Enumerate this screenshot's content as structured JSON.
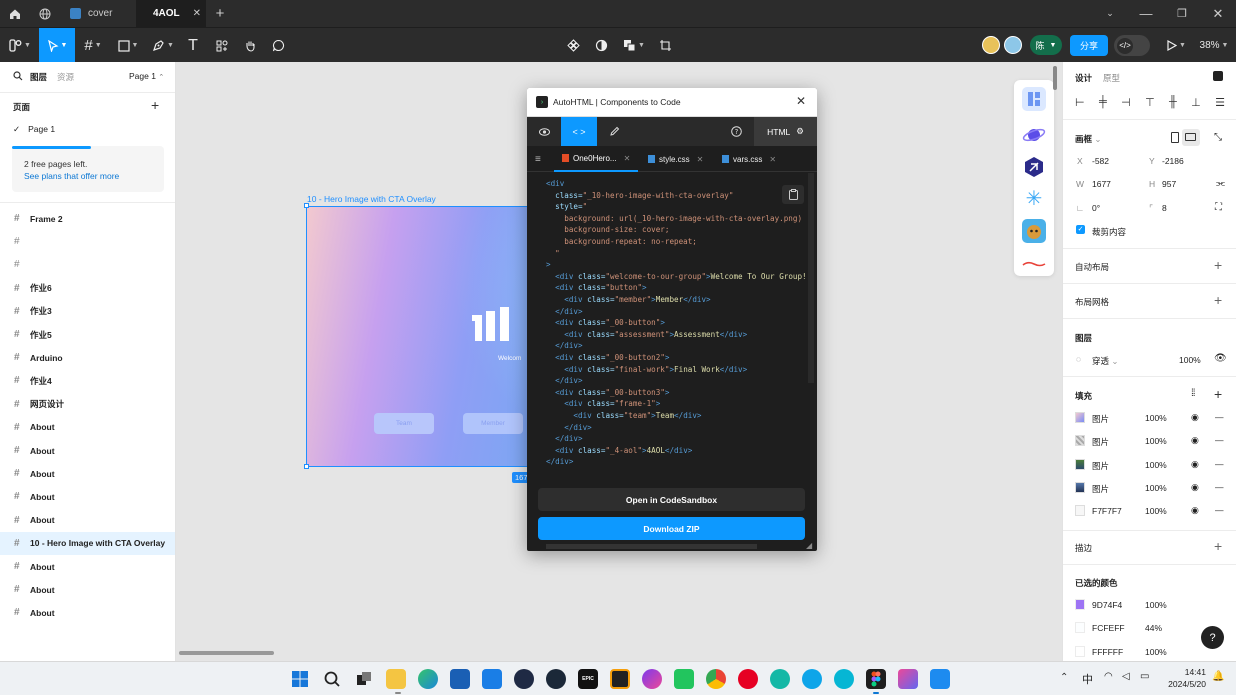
{
  "tabs": [
    {
      "label": "cover",
      "active": false
    },
    {
      "label": "4AOL",
      "active": true
    }
  ],
  "toolbar": {
    "share_label": "分享",
    "zoom": "38%",
    "avatar_letter": "陈"
  },
  "left_panel": {
    "tab_layers": "图层",
    "tab_assets": "资源",
    "page_selector": "Page 1",
    "pages_title": "页面",
    "current_page": "Page 1",
    "notice_text": "2 free pages left.",
    "notice_link": "See plans that offer more",
    "layers": [
      {
        "label": "Frame 2",
        "selected": false
      },
      {
        "label": "",
        "selected": false
      },
      {
        "label": "",
        "selected": false
      },
      {
        "label": "作业6",
        "selected": false
      },
      {
        "label": "作业3",
        "selected": false
      },
      {
        "label": "作业5",
        "selected": false
      },
      {
        "label": "Arduino",
        "selected": false
      },
      {
        "label": "作业4",
        "selected": false
      },
      {
        "label": "网页设计",
        "selected": false
      },
      {
        "label": "About",
        "selected": false
      },
      {
        "label": "About",
        "selected": false
      },
      {
        "label": "About",
        "selected": false
      },
      {
        "label": "About",
        "selected": false
      },
      {
        "label": "About",
        "selected": false
      },
      {
        "label": "10 - Hero Image with CTA Overlay",
        "selected": true
      },
      {
        "label": "About",
        "selected": false
      },
      {
        "label": "About",
        "selected": false
      },
      {
        "label": "About",
        "selected": false
      }
    ]
  },
  "canvas": {
    "frame_label": "10 - Hero Image with CTA Overlay",
    "frame_size": "167",
    "welcome_text": "Welcom",
    "btn_team": "Team",
    "btn_member": "Member"
  },
  "plugin": {
    "title": "AutoHTML | Components to Code",
    "lang": "HTML",
    "files": [
      "One0Hero...",
      "style.css",
      "vars.css"
    ],
    "code": [
      [
        [
          "t",
          "<div"
        ]
      ],
      [
        [
          "a",
          "  class="
        ],
        [
          "s",
          "\"_10-hero-image-with-cta-overlay\""
        ]
      ],
      [
        [
          "a",
          "  style="
        ],
        [
          "s",
          "\""
        ]
      ],
      [
        [
          "s",
          "    background: url(_10-hero-image-with-cta-overlay.png)"
        ]
      ],
      [
        [
          "s",
          "    background-size: cover;"
        ]
      ],
      [
        [
          "s",
          "    background-repeat: no-repeat;"
        ]
      ],
      [
        [
          "s",
          "  \""
        ]
      ],
      [
        [
          "t",
          ">"
        ]
      ],
      [
        [
          "t",
          "  <div "
        ],
        [
          "a",
          "class="
        ],
        [
          "s",
          "\"welcome-to-our-group\""
        ],
        [
          "t",
          ">"
        ],
        [
          "x",
          "Welcome To Our Group!"
        ]
      ],
      [
        [
          "t",
          "  <div "
        ],
        [
          "a",
          "class="
        ],
        [
          "s",
          "\"button\""
        ],
        [
          "t",
          ">"
        ]
      ],
      [
        [
          "t",
          "    <div "
        ],
        [
          "a",
          "class="
        ],
        [
          "s",
          "\"member\""
        ],
        [
          "t",
          ">"
        ],
        [
          "x",
          "Member"
        ],
        [
          "t",
          "</div>"
        ]
      ],
      [
        [
          "t",
          "  </div>"
        ]
      ],
      [
        [
          "t",
          "  <div "
        ],
        [
          "a",
          "class="
        ],
        [
          "s",
          "\"_00-button\""
        ],
        [
          "t",
          ">"
        ]
      ],
      [
        [
          "t",
          "    <div "
        ],
        [
          "a",
          "class="
        ],
        [
          "s",
          "\"assessment\""
        ],
        [
          "t",
          ">"
        ],
        [
          "x",
          "Assessment"
        ],
        [
          "t",
          "</div>"
        ]
      ],
      [
        [
          "t",
          "  </div>"
        ]
      ],
      [
        [
          "t",
          "  <div "
        ],
        [
          "a",
          "class="
        ],
        [
          "s",
          "\"_00-button2\""
        ],
        [
          "t",
          ">"
        ]
      ],
      [
        [
          "t",
          "    <div "
        ],
        [
          "a",
          "class="
        ],
        [
          "s",
          "\"final-work\""
        ],
        [
          "t",
          ">"
        ],
        [
          "x",
          "Final Work"
        ],
        [
          "t",
          "</div>"
        ]
      ],
      [
        [
          "t",
          "  </div>"
        ]
      ],
      [
        [
          "t",
          "  <div "
        ],
        [
          "a",
          "class="
        ],
        [
          "s",
          "\"_00-button3\""
        ],
        [
          "t",
          ">"
        ]
      ],
      [
        [
          "t",
          "    <div "
        ],
        [
          "a",
          "class="
        ],
        [
          "s",
          "\"frame-1\""
        ],
        [
          "t",
          ">"
        ]
      ],
      [
        [
          "t",
          "      <div "
        ],
        [
          "a",
          "class="
        ],
        [
          "s",
          "\"team\""
        ],
        [
          "t",
          ">"
        ],
        [
          "x",
          "Team"
        ],
        [
          "t",
          "</div>"
        ]
      ],
      [
        [
          "t",
          "    </div>"
        ]
      ],
      [
        [
          "t",
          "  </div>"
        ]
      ],
      [
        [
          "t",
          "  <div "
        ],
        [
          "a",
          "class="
        ],
        [
          "s",
          "\"_4-aol\""
        ],
        [
          "t",
          ">"
        ],
        [
          "x",
          "4AOL"
        ],
        [
          "t",
          "</div>"
        ]
      ],
      [
        [
          "t",
          "</div>"
        ]
      ]
    ],
    "btn_sandbox": "Open in CodeSandbox",
    "btn_zip": "Download ZIP"
  },
  "right_panel": {
    "tab_design": "设计",
    "tab_prototype": "原型",
    "frame_label": "画框",
    "x_label": "X",
    "x_value": "-582",
    "y_label": "Y",
    "y_value": "-2186",
    "w_label": "W",
    "w_value": "1677",
    "h_label": "H",
    "h_value": "957",
    "rotation": "0°",
    "radius": "8",
    "clip_content": "裁剪内容",
    "auto_layout": "自动布局",
    "layout_grid": "布局网格",
    "layer_title": "图层",
    "blend": "穿透",
    "layer_opacity": "100%",
    "fill_title": "填充",
    "fills": [
      {
        "label": "图片",
        "opacity": "100%"
      },
      {
        "label": "图片",
        "opacity": "100%"
      },
      {
        "label": "图片",
        "opacity": "100%"
      },
      {
        "label": "图片",
        "opacity": "100%"
      },
      {
        "label": "F7F7F7",
        "opacity": "100%"
      }
    ],
    "stroke_title": "描边",
    "selected_colors_title": "已选的颜色",
    "colors": [
      {
        "hex": "9D74F4",
        "opacity": "100%",
        "swatch": "#9D74F4"
      },
      {
        "hex": "FCFEFF",
        "opacity": "44%",
        "swatch": "#FCFEFF"
      },
      {
        "hex": "FFFFFF",
        "opacity": "100%",
        "swatch": "#FFFFFF"
      }
    ],
    "help": "?"
  },
  "taskbar": {
    "time": "14:41",
    "date": "2024/5/20",
    "ime": "中"
  },
  "colors": {
    "accent": "#0d99ff",
    "dark": "#2c2c2c"
  }
}
